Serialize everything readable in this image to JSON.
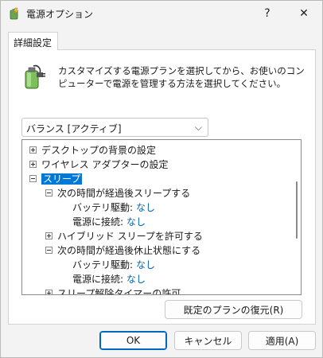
{
  "window": {
    "title": "電源オプション",
    "help_label": "?",
    "close_label": "✕"
  },
  "tab": {
    "label": "詳細設定"
  },
  "description": "カスタマイズする電源プランを選択してから、お使いのコンピューターで電源を管理する方法を選択してください。",
  "plan_select": {
    "value": "バランス [アクティブ]",
    "chevron": "⌵"
  },
  "tree": {
    "items": [
      {
        "label": "デスクトップの背景の設定",
        "expander": "plus"
      },
      {
        "label": "ワイヤレス アダプターの設定",
        "expander": "plus"
      },
      {
        "label": "スリープ",
        "expander": "minus"
      },
      {
        "label": "次の時間が経過後スリープする",
        "expander": "minus"
      },
      {
        "label": "バッテリ駆動:",
        "value": "なし"
      },
      {
        "label": "電源に接続:",
        "value": "なし"
      },
      {
        "label": "ハイブリッド スリープを許可する",
        "expander": "plus"
      },
      {
        "label": "次の時間が経過後休止状態にする",
        "expander": "minus"
      },
      {
        "label": "バッテリ駆動:",
        "value": "なし"
      },
      {
        "label": "電源に接続:",
        "value": "なし"
      },
      {
        "label": "スリープ解除タイマーの許可",
        "expander": "plus"
      }
    ]
  },
  "buttons": {
    "restore": "既定のプランの復元(R)",
    "ok": "OK",
    "cancel": "キャンセル",
    "apply": "適用(A)"
  },
  "colors": {
    "accent": "#0078d7",
    "value_link": "#0063b1"
  }
}
